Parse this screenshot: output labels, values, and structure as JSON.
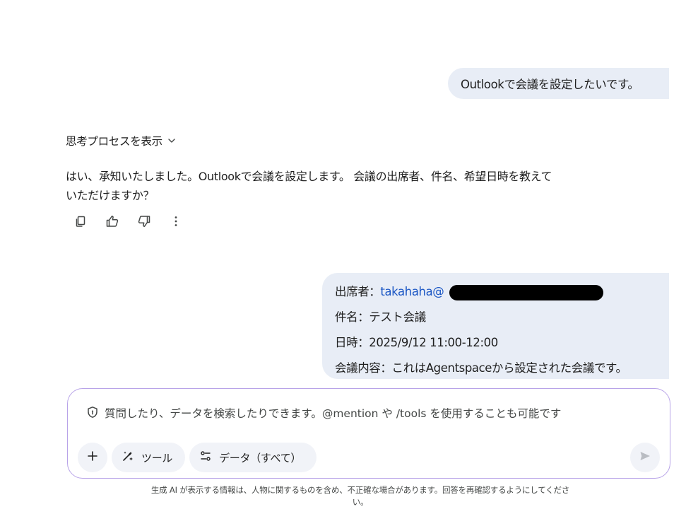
{
  "conversation": {
    "user_message_1": "Outlookで会議を設定したいです。",
    "thinking_toggle_label": "思考プロセスを表示",
    "ai_response": {
      "line1": "はい、承知いたしました。Outlookで会議を設定します。 会議の出席者、件名、希望日時を教えて",
      "line2": "いただけますか？"
    },
    "feedback_actions": [
      "copy-icon",
      "thumbs-up-icon",
      "thumbs-down-icon",
      "more-vert-icon"
    ],
    "user_message_2": {
      "attendee_label": "出席者：",
      "attendee_email": "takahaha@",
      "subject": "件名：テスト会議",
      "datetime": "日時：2025/9/12 11:00-12:00",
      "content": "会議内容：これはAgentspaceから設定された会議です。"
    }
  },
  "composer": {
    "placeholder": "質問したり、データを検索したりできます。@mention や /tools を使用することも可能です",
    "tools_label": "ツール",
    "data_label": "データ（すべて）"
  },
  "disclaimer": {
    "line1": "生成 AI が表示する情報は、人物に関するものを含め、不正確な場合があります。回答を再確認するようにしてくださ",
    "line2": "い。"
  },
  "colors": {
    "user_bubble": "#e8edf6",
    "composer_border": "#b8a3e8",
    "email_link": "#1a56c4",
    "pill_bg": "#f1f3f8"
  }
}
